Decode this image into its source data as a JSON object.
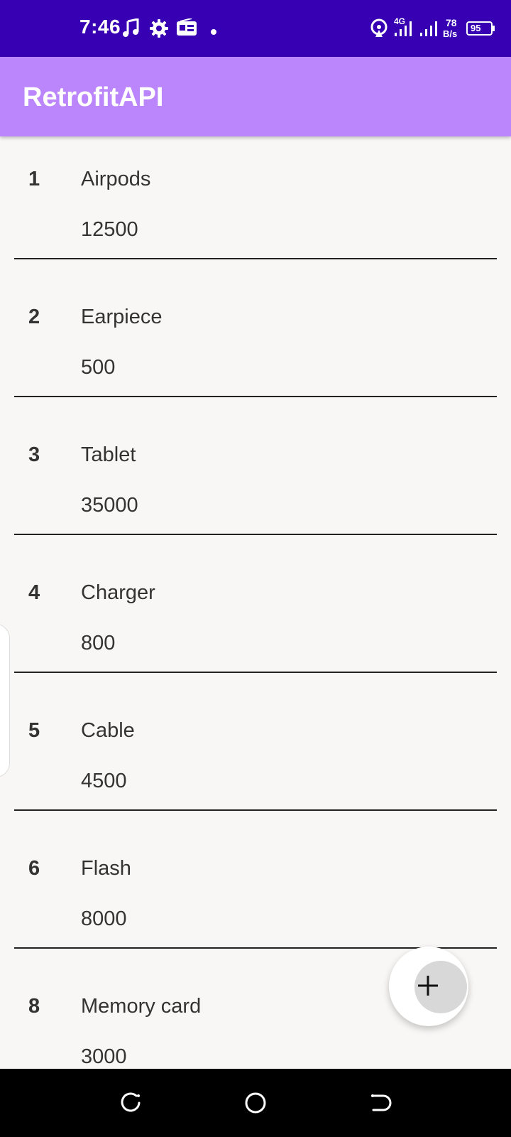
{
  "status_bar": {
    "time": "7:46",
    "network_type": "4G",
    "speed_value": "78",
    "speed_unit": "B/s",
    "battery": "95",
    "icons": [
      "music-icon",
      "settings-icon",
      "radio-icon",
      "dot-icon",
      "hotspot-icon",
      "signal-icon",
      "signal-icon",
      "battery-icon"
    ]
  },
  "app_bar": {
    "title": "RetrofitAPI"
  },
  "items": [
    {
      "id": "1",
      "name": "Airpods",
      "price": "12500"
    },
    {
      "id": "2",
      "name": "Earpiece",
      "price": "500"
    },
    {
      "id": "3",
      "name": "Tablet",
      "price": "35000"
    },
    {
      "id": "4",
      "name": "Charger",
      "price": "800"
    },
    {
      "id": "5",
      "name": "Cable",
      "price": "4500"
    },
    {
      "id": "6",
      "name": "Flash",
      "price": "8000"
    },
    {
      "id": "8",
      "name": "Memory card",
      "price": "3000"
    }
  ],
  "fab": {
    "icon": "plus-icon"
  },
  "nav_bar": {
    "icons": [
      "recents-icon",
      "home-icon",
      "back-icon"
    ]
  },
  "colors": {
    "status_bar": "#3700b3",
    "app_bar": "#bb86fc",
    "background": "#f8f7f6",
    "text": "#333333"
  }
}
